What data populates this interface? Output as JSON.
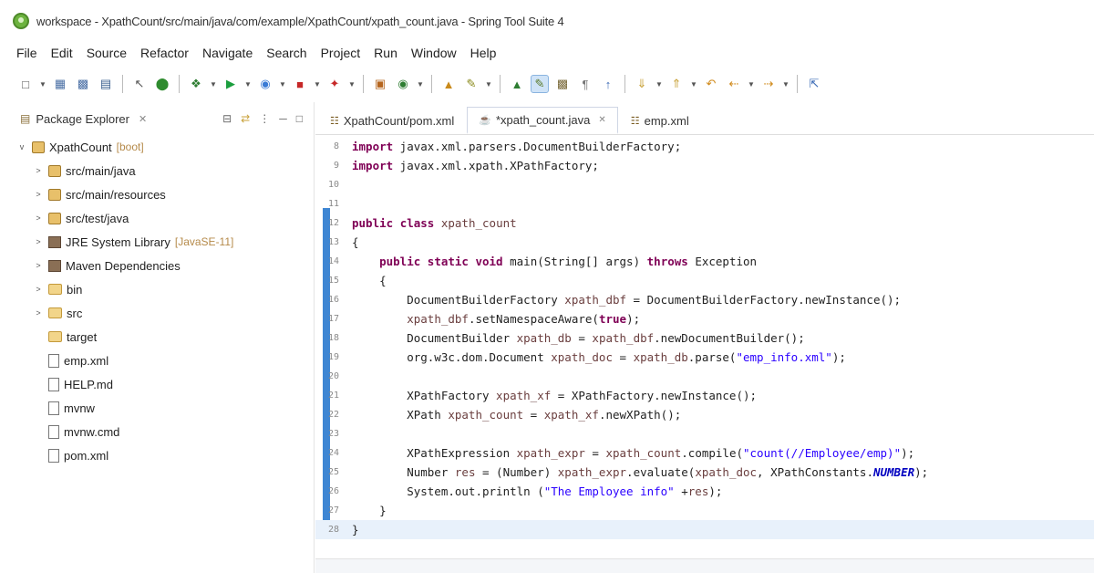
{
  "window": {
    "title": "workspace - XpathCount/src/main/java/com/example/XpathCount/xpath_count.java - Spring Tool Suite 4"
  },
  "menu": [
    "File",
    "Edit",
    "Source",
    "Refactor",
    "Navigate",
    "Search",
    "Project",
    "Run",
    "Window",
    "Help"
  ],
  "explorer": {
    "title": "Package Explorer",
    "items": [
      {
        "label": "XpathCount",
        "deco": "[boot]",
        "icon": "project-icon",
        "expander": "v",
        "indent": 0
      },
      {
        "label": "src/main/java",
        "deco": "",
        "icon": "package-folder-icon",
        "expander": ">",
        "indent": 1
      },
      {
        "label": "src/main/resources",
        "deco": "",
        "icon": "package-folder-icon",
        "expander": ">",
        "indent": 1
      },
      {
        "label": "src/test/java",
        "deco": "",
        "icon": "package-folder-icon",
        "expander": ">",
        "indent": 1
      },
      {
        "label": "JRE System Library",
        "deco": "[JavaSE-11]",
        "icon": "library-icon",
        "expander": ">",
        "indent": 1
      },
      {
        "label": "Maven Dependencies",
        "deco": "",
        "icon": "library-icon",
        "expander": ">",
        "indent": 1
      },
      {
        "label": "bin",
        "deco": "",
        "icon": "folder-icon",
        "expander": ">",
        "indent": 1
      },
      {
        "label": "src",
        "deco": "",
        "icon": "folder-icon",
        "expander": ">",
        "indent": 1
      },
      {
        "label": "target",
        "deco": "",
        "icon": "folder-icon",
        "expander": "",
        "indent": 1
      },
      {
        "label": "emp.xml",
        "deco": "",
        "icon": "xml-file-icon",
        "expander": "",
        "indent": 1
      },
      {
        "label": "HELP.md",
        "deco": "",
        "icon": "text-file-icon",
        "expander": "",
        "indent": 1
      },
      {
        "label": "mvnw",
        "deco": "",
        "icon": "text-file-icon",
        "expander": "",
        "indent": 1
      },
      {
        "label": "mvnw.cmd",
        "deco": "",
        "icon": "text-file-icon",
        "expander": "",
        "indent": 1
      },
      {
        "label": "pom.xml",
        "deco": "",
        "icon": "xml-file-icon",
        "expander": "",
        "indent": 1
      }
    ]
  },
  "editor": {
    "tabs": [
      {
        "label": "XpathCount/pom.xml",
        "icon": "xml-file-icon",
        "active": false
      },
      {
        "label": "*xpath_count.java",
        "icon": "java-file-icon",
        "active": true
      },
      {
        "label": "emp.xml",
        "icon": "xml-file-icon",
        "active": false
      }
    ],
    "lines": [
      {
        "n": "8",
        "code": "import javax.xml.parsers.DocumentBuilderFactory;"
      },
      {
        "n": "9",
        "code": "import javax.xml.xpath.XPathFactory;"
      },
      {
        "n": "10",
        "code": ""
      },
      {
        "n": "11",
        "code": ""
      },
      {
        "n": "12",
        "code": "public class xpath_count"
      },
      {
        "n": "13",
        "code": "{"
      },
      {
        "n": "14",
        "code": "    public static void main(String[] args) throws Exception"
      },
      {
        "n": "15",
        "code": "    {"
      },
      {
        "n": "16",
        "code": "        DocumentBuilderFactory xpath_dbf = DocumentBuilderFactory.newInstance();"
      },
      {
        "n": "17",
        "code": "        xpath_dbf.setNamespaceAware(true);"
      },
      {
        "n": "18",
        "code": "        DocumentBuilder xpath_db = xpath_dbf.newDocumentBuilder();"
      },
      {
        "n": "19",
        "code": "        org.w3c.dom.Document xpath_doc = xpath_db.parse(\"emp_info.xml\");"
      },
      {
        "n": "20",
        "code": ""
      },
      {
        "n": "21",
        "code": "        XPathFactory xpath_xf = XPathFactory.newInstance();"
      },
      {
        "n": "22",
        "code": "        XPath xpath_count = xpath_xf.newXPath();"
      },
      {
        "n": "23",
        "code": ""
      },
      {
        "n": "24",
        "code": "        XPathExpression xpath_expr = xpath_count.compile(\"count(//Employee/emp)\");"
      },
      {
        "n": "25",
        "code": "        Number res = (Number) xpath_expr.evaluate(xpath_doc, XPathConstants.NUMBER);"
      },
      {
        "n": "26",
        "code": "        System.out.println (\"The Employee info\" +res);"
      },
      {
        "n": "27",
        "code": "    }"
      },
      {
        "n": "28",
        "code": "}"
      }
    ]
  }
}
